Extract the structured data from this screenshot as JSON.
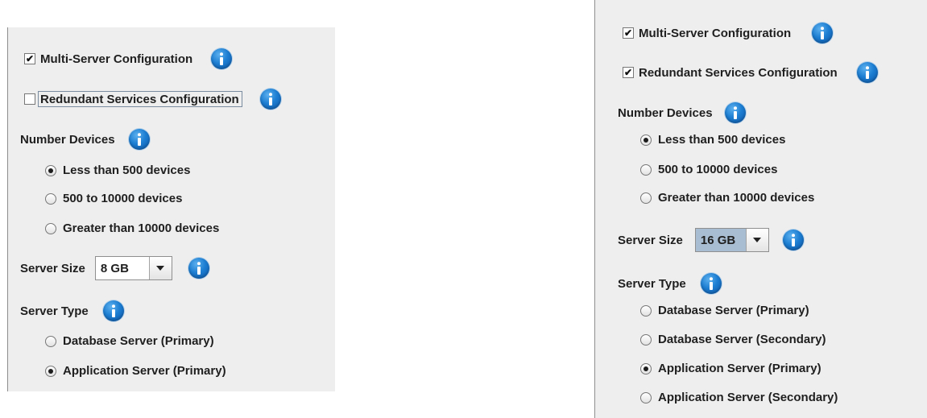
{
  "left_panel": {
    "multi_server": {
      "label": "Multi-Server Configuration",
      "checked": true
    },
    "redundant": {
      "label": "Redundant Services Configuration",
      "checked": false,
      "focused": true
    },
    "number_devices": {
      "label": "Number Devices",
      "options": [
        {
          "label": "Less than 500 devices",
          "selected": true
        },
        {
          "label": "500 to 10000 devices",
          "selected": false
        },
        {
          "label": "Greater than 10000 devices",
          "selected": false
        }
      ]
    },
    "server_size": {
      "label": "Server Size",
      "value": "8 GB"
    },
    "server_type": {
      "label": "Server Type",
      "options": [
        {
          "label": "Database Server (Primary)",
          "selected": false
        },
        {
          "label": "Application Server (Primary)",
          "selected": true
        }
      ]
    }
  },
  "right_panel": {
    "multi_server": {
      "label": "Multi-Server Configuration",
      "checked": true
    },
    "redundant": {
      "label": "Redundant Services Configuration",
      "checked": true
    },
    "number_devices": {
      "label": "Number Devices",
      "options": [
        {
          "label": "Less than 500 devices",
          "selected": true
        },
        {
          "label": "500 to 10000 devices",
          "selected": false
        },
        {
          "label": "Greater than 10000 devices",
          "selected": false
        }
      ]
    },
    "server_size": {
      "label": "Server Size",
      "value": "16 GB"
    },
    "server_type": {
      "label": "Server Type",
      "options": [
        {
          "label": "Database Server (Primary)",
          "selected": false
        },
        {
          "label": "Database Server (Secondary)",
          "selected": false
        },
        {
          "label": "Application Server (Primary)",
          "selected": true
        },
        {
          "label": "Application Server (Secondary)",
          "selected": false
        }
      ]
    }
  },
  "icons": {
    "info": "info-icon",
    "dropdown": "chevron-down-icon",
    "check": "check-icon"
  },
  "colors": {
    "panel_bg": "#eeeeee",
    "info_blue": "#1d7ed2",
    "combo_selected_bg": "#a9bdd2"
  }
}
